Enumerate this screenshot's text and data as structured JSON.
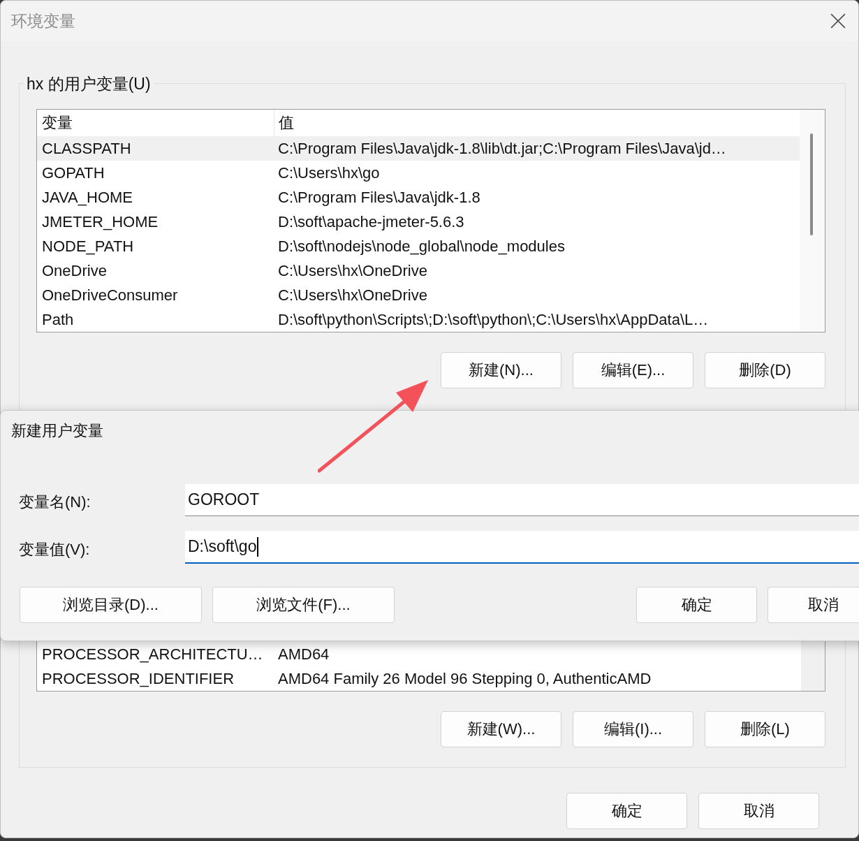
{
  "window": {
    "title": "环境变量"
  },
  "user_variables": {
    "label": "hx 的用户变量(U)",
    "columns": [
      "变量",
      "值"
    ],
    "rows": [
      {
        "name": "CLASSPATH",
        "value": "C:\\Program Files\\Java\\jdk-1.8\\lib\\dt.jar;C:\\Program Files\\Java\\jd…",
        "selected": true
      },
      {
        "name": "GOPATH",
        "value": "C:\\Users\\hx\\go",
        "selected": false
      },
      {
        "name": "JAVA_HOME",
        "value": "C:\\Program Files\\Java\\jdk-1.8",
        "selected": false
      },
      {
        "name": "JMETER_HOME",
        "value": "D:\\soft\\apache-jmeter-5.6.3",
        "selected": false
      },
      {
        "name": "NODE_PATH",
        "value": "D:\\soft\\nodejs\\node_global\\node_modules",
        "selected": false
      },
      {
        "name": "OneDrive",
        "value": "C:\\Users\\hx\\OneDrive",
        "selected": false
      },
      {
        "name": "OneDriveConsumer",
        "value": "C:\\Users\\hx\\OneDrive",
        "selected": false
      },
      {
        "name": "Path",
        "value": "D:\\soft\\python\\Scripts\\;D:\\soft\\python\\;C:\\Users\\hx\\AppData\\L…",
        "selected": false
      }
    ],
    "buttons": [
      "新建(N)...",
      "编辑(E)...",
      "删除(D)"
    ]
  },
  "system_variables": {
    "rows": [
      {
        "name": "PROCESSOR_ARCHITECTU…",
        "value": "AMD64",
        "selected": false
      },
      {
        "name": "PROCESSOR_IDENTIFIER",
        "value": "AMD64 Family 26 Model 96 Stepping 0, AuthenticAMD",
        "selected": false
      }
    ],
    "buttons": [
      "新建(W)...",
      "编辑(I)...",
      "删除(L)"
    ]
  },
  "buttons": [
    "确定",
    "取消"
  ],
  "dialog": {
    "title": "新建用户变量",
    "fields": [
      {
        "label": "变量名(N):",
        "value": "GOROOT",
        "focused": false
      },
      {
        "label": "变量值(V):",
        "value": "D:\\soft\\go",
        "focused": true
      }
    ],
    "buttons": [
      "浏览目录(D)...",
      "浏览文件(F)..."
    ],
    "actions": [
      "确定",
      "取消"
    ]
  }
}
